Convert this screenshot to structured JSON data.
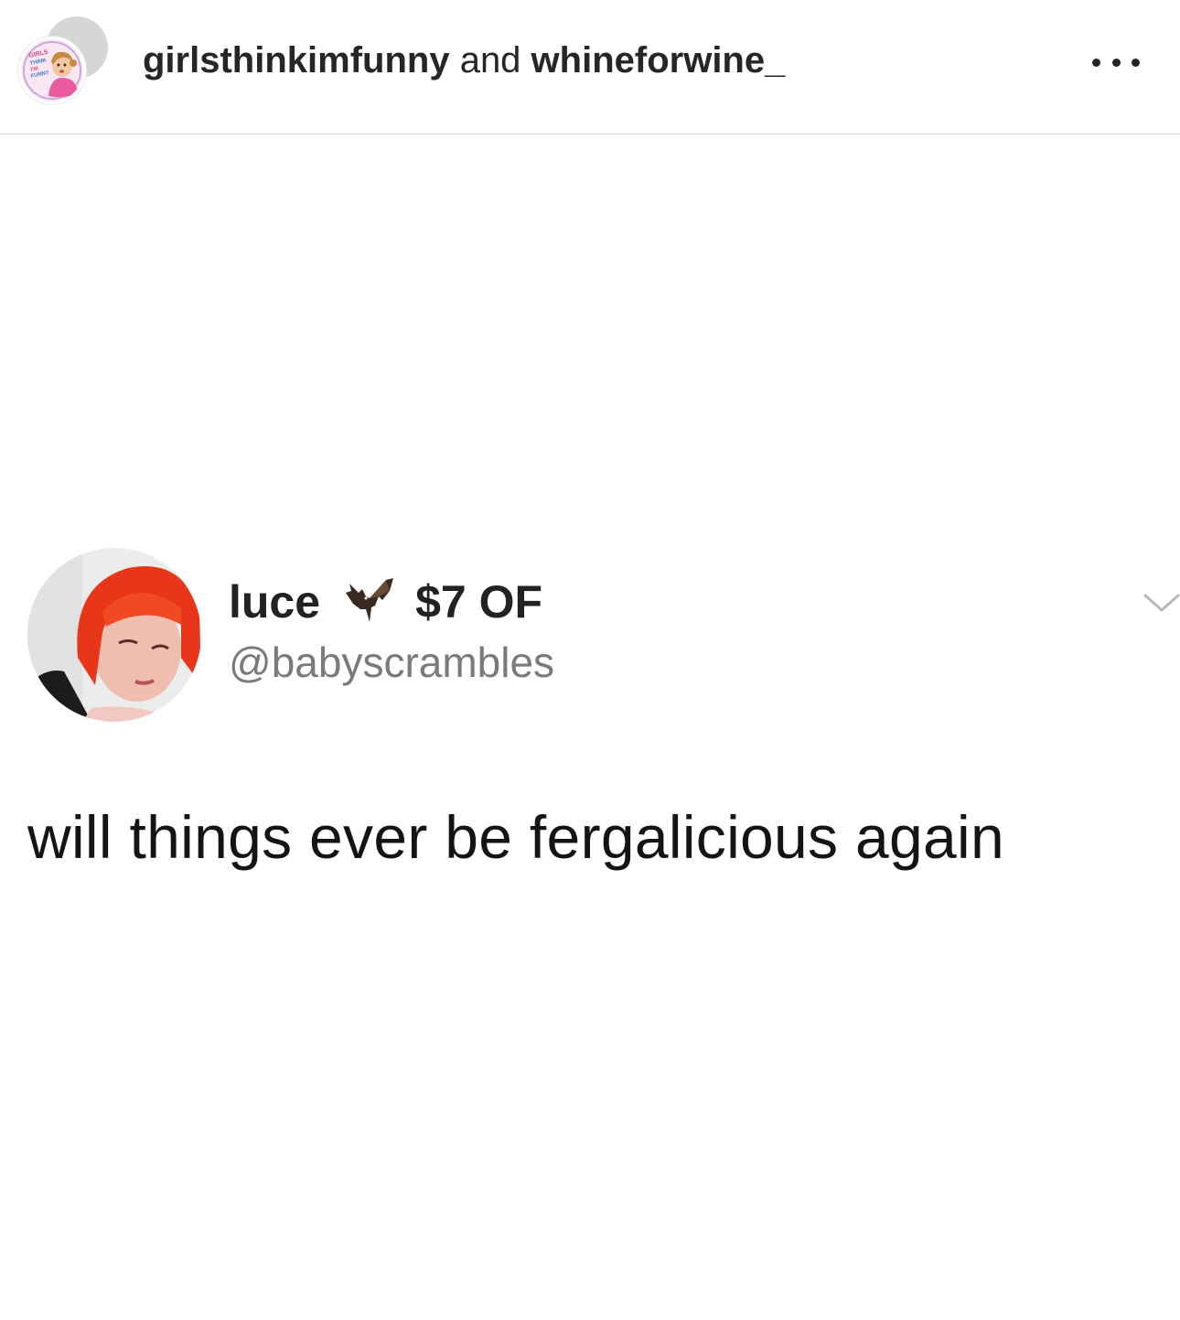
{
  "header": {
    "account_primary": "girlsthinkimfunny",
    "conjunction": " and ",
    "account_secondary": "whineforwine_",
    "avatar_logo_lines": [
      "GIRLS",
      "THINK",
      "I'M",
      "FUNNY"
    ],
    "more_icon": "more-horizontal-icon"
  },
  "tweet": {
    "display_name": "luce",
    "emoji_icon": "bat-icon",
    "name_suffix": "$7 OF",
    "handle": "@babyscrambles",
    "text": "will things ever be fergalicious again",
    "menu_icon": "chevron-down-icon"
  },
  "colors": {
    "text_primary": "#262626",
    "handle_gray": "#7a7a7a",
    "divider": "#dbdbdb",
    "avatar_hair": "#e8361a"
  }
}
